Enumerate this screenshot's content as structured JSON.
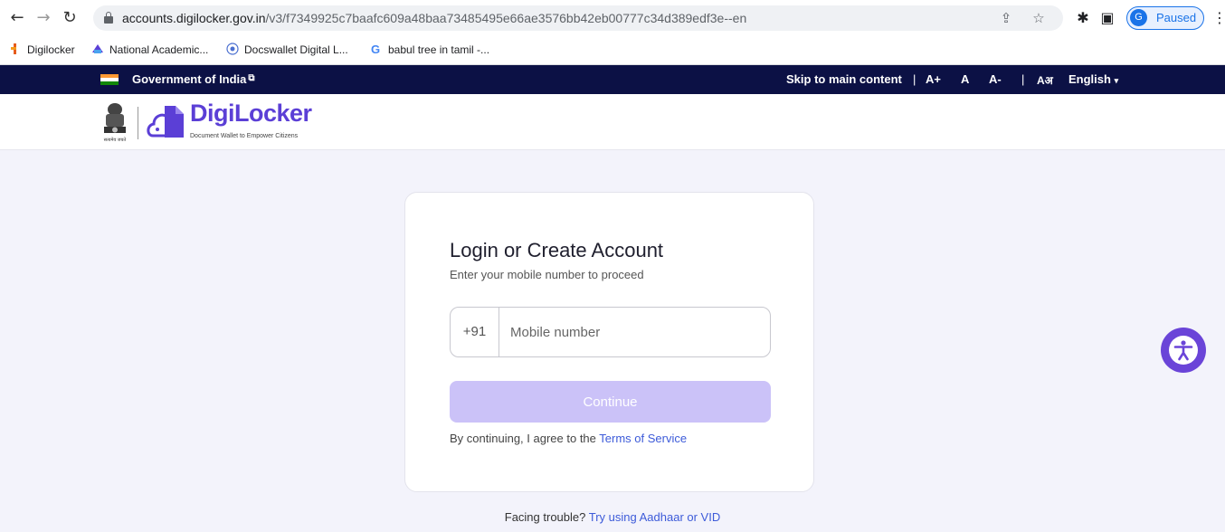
{
  "browser": {
    "url_host": "accounts.digilocker.gov.in",
    "url_path": "/v3/f7349925c7baafc609a48baa73485495e66ae3576bb42eb00777c34d389edf3e--en",
    "profile_initial": "G",
    "profile_status": "Paused",
    "bookmarks": [
      {
        "label": "Digilocker"
      },
      {
        "label": "National Academic..."
      },
      {
        "label": "Docswallet Digital L..."
      },
      {
        "label": "babul tree in tamil -..."
      }
    ]
  },
  "gov_bar": {
    "title": "Government of India",
    "skip_link": "Skip to main content",
    "font_increase": "A+",
    "font_normal": "A",
    "font_decrease": "A-",
    "divider": "|",
    "language_icon": "Aअ",
    "language": "English",
    "language_caret": "▾"
  },
  "header": {
    "brand": "DigiLocker",
    "tagline": "Document Wallet to Empower Citizens",
    "emblem_caption": "सत्यमेव जयते"
  },
  "login": {
    "title": "Login or Create Account",
    "subtitle": "Enter your mobile number to proceed",
    "country_code": "+91",
    "mobile_placeholder": "Mobile number",
    "continue_label": "Continue",
    "terms_prefix": "By continuing, I agree to the ",
    "terms_link": "Terms of Service"
  },
  "footer": {
    "trouble_prefix": "Facing trouble? ",
    "trouble_link": "Try using Aadhaar or VID"
  },
  "colors": {
    "gov_bar": "#0c1145",
    "brand": "#5b3fd6",
    "button_disabled": "#cbc2f8",
    "link": "#3d5bd9",
    "accessibility": "#6a44d8"
  }
}
